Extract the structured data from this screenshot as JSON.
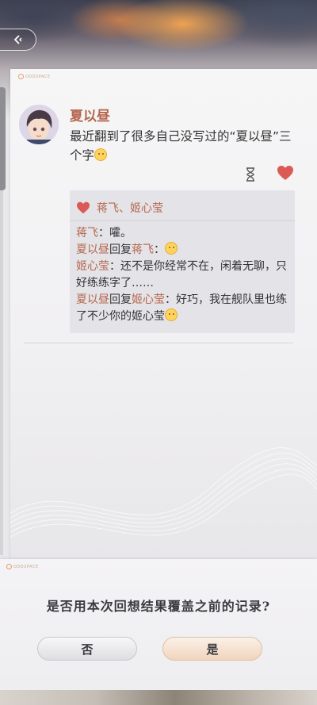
{
  "header": {
    "back_icon": "chevron-left-icon"
  },
  "card": {
    "brand": "ODDSPACE",
    "post": {
      "username": "夏以昼",
      "text": "最近翻到了很多自己没写过的“夏以昼”三个字"
    },
    "icons": {
      "timer": "hourglass-icon",
      "like": "heart-icon"
    },
    "likes": "蒋飞、姬心莹",
    "comments": [
      {
        "name": "蒋飞",
        "sep": "：",
        "text": "嚯。"
      },
      {
        "name": "夏以昼",
        "mid": "回复",
        "to": "蒋飞",
        "sep": "：",
        "text": ""
      },
      {
        "name": "姬心莹",
        "sep": "：",
        "text": "还不是你经常不在，闲着无聊，只好练练字了……"
      },
      {
        "name": "夏以昼",
        "mid": "回复",
        "to": "姬心莹",
        "sep": "：",
        "text": "好巧，我在舰队里也练了不少你的姬心莹"
      }
    ]
  },
  "dialog": {
    "brand": "ODDSPACE",
    "message": "是否用本次回想结果覆盖之前的记录?",
    "no_label": "否",
    "yes_label": "是"
  },
  "colors": {
    "name": "#b5664d",
    "heart": "#dc5a55"
  }
}
